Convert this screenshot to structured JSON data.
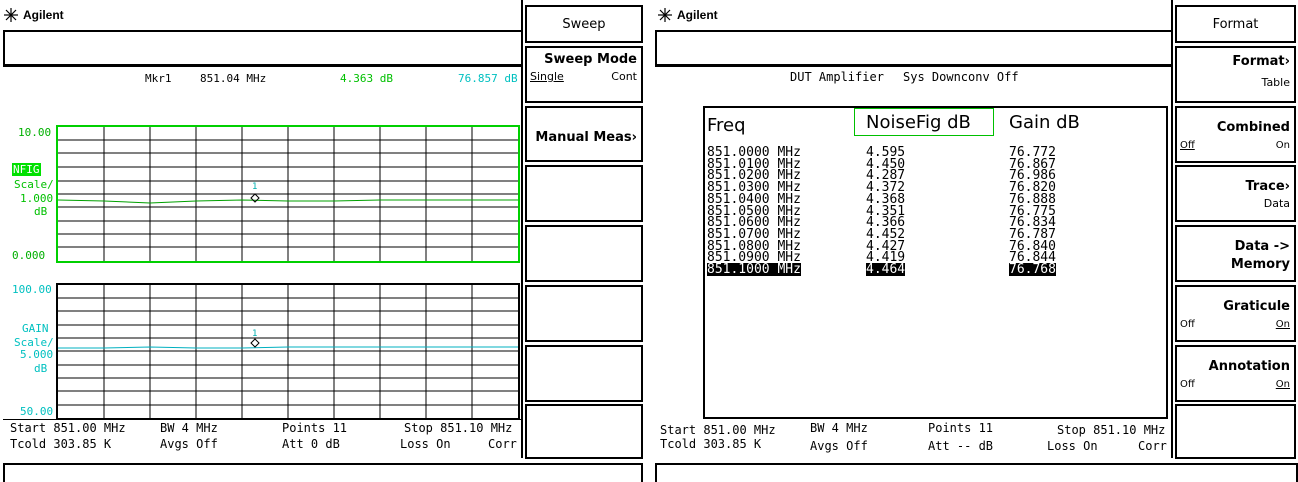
{
  "brand": "Agilent",
  "left": {
    "marker": {
      "label": "Mkr1",
      "freq": "851.04 MHz",
      "nf": "4.363 dB",
      "gain": "76.857 dB"
    },
    "nfig": {
      "top": "10.00",
      "label": "NFIG",
      "scale": "Scale/",
      "scale_val": "1.000",
      "unit": "dB",
      "bottom": "0.000",
      "marker": "1"
    },
    "gain": {
      "top": "100.00",
      "label": "GAIN",
      "scale": "Scale/",
      "scale_val": "5.000",
      "unit": "dB",
      "bottom": "50.00",
      "marker": "1"
    },
    "footer": {
      "start": "Start 851.00 MHz",
      "bw": "BW 4 MHz",
      "points": "Points 11",
      "stop": "Stop 851.10 MHz",
      "tcold": "Tcold 303.85 K",
      "avgs": "Avgs Off",
      "att": "Att 0 dB",
      "loss": "Loss On",
      "corr": "Corr"
    },
    "softkeys": {
      "title": "Sweep",
      "sweep_mode": {
        "label": "Sweep Mode",
        "opt1": "Single",
        "opt2": "Cont"
      },
      "manual_meas": {
        "label": "Manual Meas"
      }
    }
  },
  "right": {
    "header": {
      "dut": "DUT Amplifier",
      "sys": "Sys Downconv Off"
    },
    "table": {
      "columns": [
        "Freq",
        "NoiseFig dB",
        "Gain dB"
      ],
      "rows": [
        [
          "851.0000 MHz",
          "4.595",
          "76.772"
        ],
        [
          "851.0100 MHz",
          "4.450",
          "76.867"
        ],
        [
          "851.0200 MHz",
          "4.287",
          "76.986"
        ],
        [
          "851.0300 MHz",
          "4.372",
          "76.820"
        ],
        [
          "851.0400 MHz",
          "4.368",
          "76.888"
        ],
        [
          "851.0500 MHz",
          "4.351",
          "76.775"
        ],
        [
          "851.0600 MHz",
          "4.366",
          "76.834"
        ],
        [
          "851.0700 MHz",
          "4.452",
          "76.787"
        ],
        [
          "851.0800 MHz",
          "4.427",
          "76.840"
        ],
        [
          "851.0900 MHz",
          "4.419",
          "76.844"
        ],
        [
          "851.1000 MHz",
          "4.464",
          "76.768"
        ]
      ],
      "selected_row": 10
    },
    "footer": {
      "start": "Start 851.00 MHz",
      "bw": "BW 4 MHz",
      "points": "Points 11",
      "stop": "Stop 851.10 MHz",
      "tcold": "Tcold 303.85 K",
      "avgs": "Avgs Off",
      "att": "Att -- dB",
      "loss": "Loss On",
      "corr": "Corr"
    },
    "softkeys": {
      "title": "Format",
      "format": {
        "label": "Format",
        "sub": "Table"
      },
      "combined": {
        "label": "Combined",
        "off": "Off",
        "on": "On"
      },
      "trace": {
        "label": "Trace",
        "sub": "Data"
      },
      "data_memory": {
        "label1": "Data ->",
        "label2": "Memory"
      },
      "graticule": {
        "label": "Graticule",
        "off": "Off",
        "on": "On"
      },
      "annotation": {
        "label": "Annotation",
        "off": "Off",
        "on": "On"
      }
    }
  },
  "colors": {
    "nfig": "#00c000",
    "gain": "#00c0c0",
    "nfig_trace": "#00a000",
    "gain_trace": "#00b0c0"
  }
}
